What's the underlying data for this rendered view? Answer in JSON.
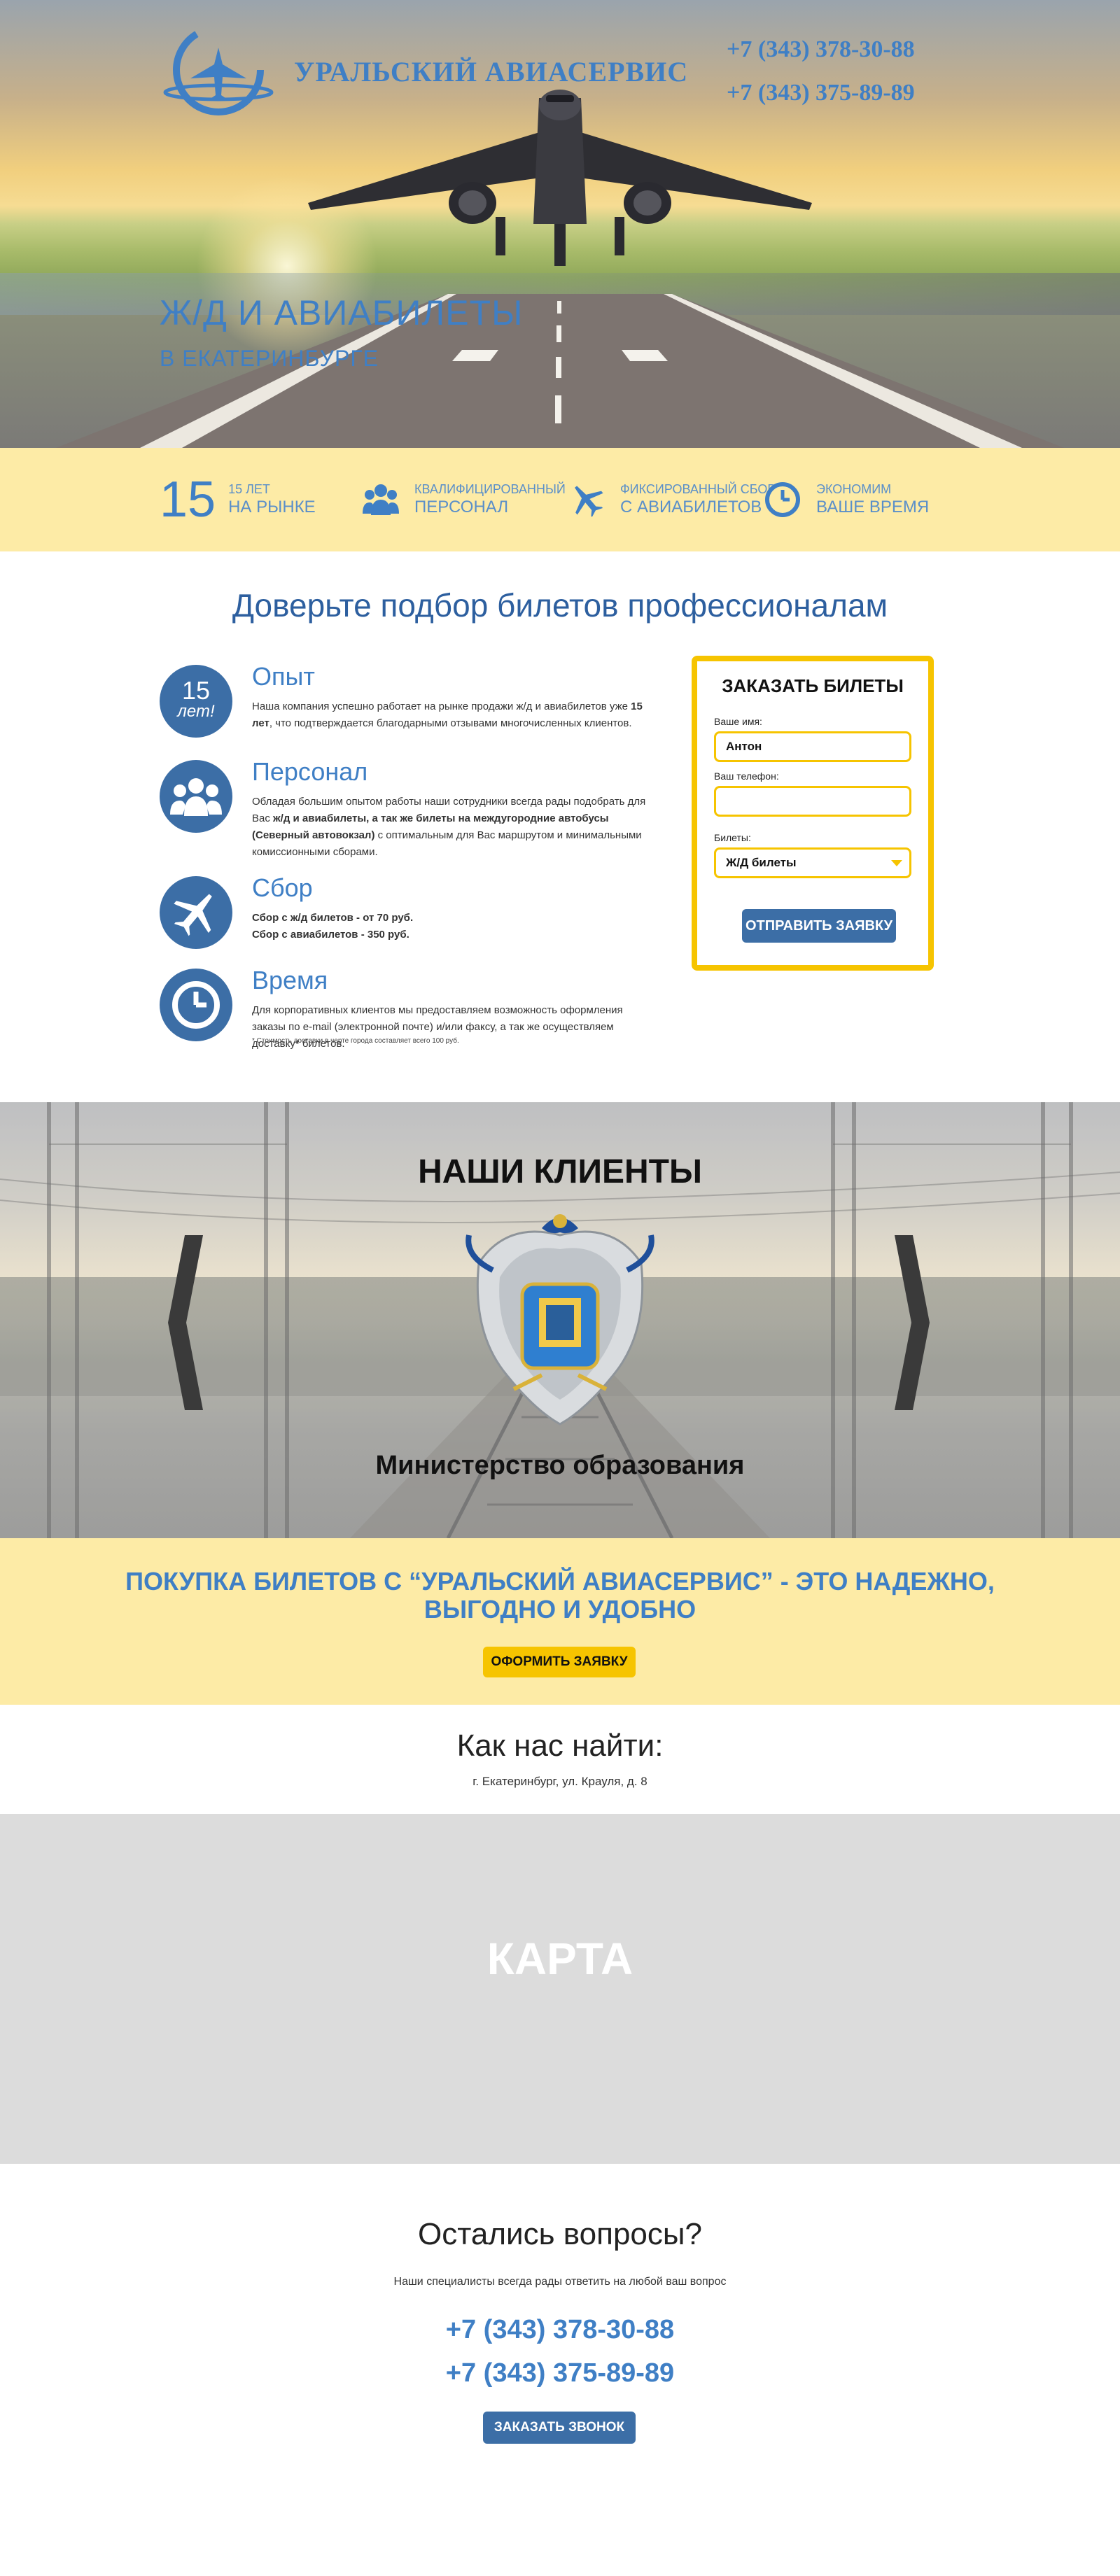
{
  "header": {
    "company": "УРАЛЬСКИЙ АВИАСЕРВИС",
    "phones": [
      "+7 (343) 378-30-88",
      "+7 (343) 375-89-89"
    ]
  },
  "hero": {
    "title": "Ж/Д И АВИАБИЛЕТЫ",
    "subtitle": "В ЕКАТЕРИНБУРГЕ"
  },
  "stats": [
    {
      "number": "15",
      "line1": "15 ЛЕТ",
      "line2": "НА РЫНКЕ",
      "icon": "calendar-number"
    },
    {
      "line1": "КВАЛИФИЦИРОВАННЫЙ",
      "line2": "ПЕРСОНАЛ",
      "icon": "people-icon"
    },
    {
      "line1": "ФИКСИРОВАННЫЙ СБОР",
      "line2": "С АВИАБИЛЕТОВ",
      "icon": "plane-icon"
    },
    {
      "line1": "ЭКОНОМИМ",
      "line2": "ВАШЕ ВРЕМЯ",
      "icon": "clock-icon"
    }
  ],
  "advantages": {
    "title": "Доверьте подбор билетов профессионалам",
    "experience": {
      "heading": "Опыт",
      "badge_number": "15",
      "badge_word": "лет!",
      "text_a": "Наша компания успешно работает на рынке продажи ж/д и авиабилетов уже ",
      "text_b": "15 лет",
      "text_c": ", что подтверждается благодарными отзывами многочисленных клиентов."
    },
    "staff": {
      "heading": "Персонал",
      "text_a": "Обладая большим опытом работы наши сотрудники всегда рады подобрать для Вас ",
      "text_b": "ж/д и авиабилеты, а так же билеты на междугородние автобусы (Северный автовокзал)",
      "text_c": " с оптимальным для Вас маршрутом и минимальными комиссионными сборами."
    },
    "fee": {
      "heading": "Сбор",
      "line1": "Сбор с ж/д билетов - от 70 руб.",
      "line2": "Сбор с авиабилетов - 350 руб."
    },
    "time": {
      "heading": "Время",
      "text": "Для корпоративных клиентов мы предоставляем возможность оформления заказы по e-mail (электронной почте) и/или факсу, а так же осуществляем доставку* билетов.",
      "note": "* Стоимость доставки в черте города составляет всего 100 руб."
    }
  },
  "order_form": {
    "title": "ЗАКАЗАТЬ БИЛЕТЫ",
    "name_label": "Ваше имя:",
    "name_value": "Антон",
    "phone_label": "Ваш телефон:",
    "phone_value": "",
    "tickets_label": "Билеты:",
    "tickets_selected": "Ж/Д билеты",
    "submit_label": "ОТПРАВИТЬ ЗАЯВКУ"
  },
  "clients": {
    "title": "НАШИ КЛИЕНТЫ",
    "current_client": "Министерство образования"
  },
  "cta": {
    "line1": "ПОКУПКА БИЛЕТОВ С “УРАЛЬСКИЙ АВИАСЕРВИС” - ЭТО НАДЕЖНО,",
    "line2": "ВЫГОДНО И УДОБНО",
    "button": "ОФОРМИТЬ ЗАЯВКУ"
  },
  "location": {
    "title": "Как нас найти:",
    "address": "г. Екатеринбург, ул. Крауля, д. 8",
    "map_label": "КАРТА"
  },
  "questions": {
    "title": "Остались вопросы?",
    "subtitle": "Наши специалисты всегда рады ответить на любой ваш вопрос",
    "phones": [
      "+7 (343) 378-30-88",
      "+7 (343) 375-89-89"
    ],
    "button": "ЗАКАЗАТЬ ЗВОНОК"
  },
  "colors": {
    "brand_blue": "#3f7fc5",
    "button_blue": "#3c6ea6",
    "accent_yellow": "#f6c400",
    "band_yellow": "#fdeba6",
    "map_gray": "#dcdcdc"
  }
}
